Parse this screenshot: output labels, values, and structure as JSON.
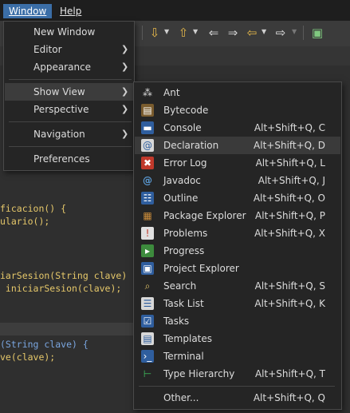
{
  "menubar": {
    "window_label": "Window",
    "help_label": "Help"
  },
  "code_lines": [
    "ficacion() {",
    "ulario();",
    "iarSesion(String clave)",
    " iniciarSesion(clave);",
    "(String clave) {",
    "ve(clave);"
  ],
  "window_menu": {
    "new_window": "New Window",
    "editor": "Editor",
    "appearance": "Appearance",
    "show_view": "Show View",
    "perspective": "Perspective",
    "navigation": "Navigation",
    "preferences": "Preferences"
  },
  "show_view": {
    "items": [
      {
        "label": "Ant",
        "shortcut": "",
        "icon": "ant-icon"
      },
      {
        "label": "Bytecode",
        "shortcut": "",
        "icon": "bytecode-icon"
      },
      {
        "label": "Console",
        "shortcut": "Alt+Shift+Q, C",
        "icon": "console-icon"
      },
      {
        "label": "Declaration",
        "shortcut": "Alt+Shift+Q, D",
        "icon": "declaration-icon"
      },
      {
        "label": "Error Log",
        "shortcut": "Alt+Shift+Q, L",
        "icon": "error-log-icon"
      },
      {
        "label": "Javadoc",
        "shortcut": "Alt+Shift+Q, J",
        "icon": "javadoc-icon"
      },
      {
        "label": "Outline",
        "shortcut": "Alt+Shift+Q, O",
        "icon": "outline-icon"
      },
      {
        "label": "Package Explorer",
        "shortcut": "Alt+Shift+Q, P",
        "icon": "package-explorer-icon"
      },
      {
        "label": "Problems",
        "shortcut": "Alt+Shift+Q, X",
        "icon": "problems-icon"
      },
      {
        "label": "Progress",
        "shortcut": "",
        "icon": "progress-icon"
      },
      {
        "label": "Project Explorer",
        "shortcut": "",
        "icon": "project-explorer-icon"
      },
      {
        "label": "Search",
        "shortcut": "Alt+Shift+Q, S",
        "icon": "search-icon"
      },
      {
        "label": "Task List",
        "shortcut": "Alt+Shift+Q, K",
        "icon": "task-list-icon"
      },
      {
        "label": "Tasks",
        "shortcut": "",
        "icon": "tasks-icon"
      },
      {
        "label": "Templates",
        "shortcut": "",
        "icon": "templates-icon"
      },
      {
        "label": "Terminal",
        "shortcut": "",
        "icon": "terminal-icon"
      },
      {
        "label": "Type Hierarchy",
        "shortcut": "Alt+Shift+Q, T",
        "icon": "type-hierarchy-icon"
      }
    ],
    "other": {
      "label": "Other...",
      "shortcut": "Alt+Shift+Q, Q"
    }
  }
}
